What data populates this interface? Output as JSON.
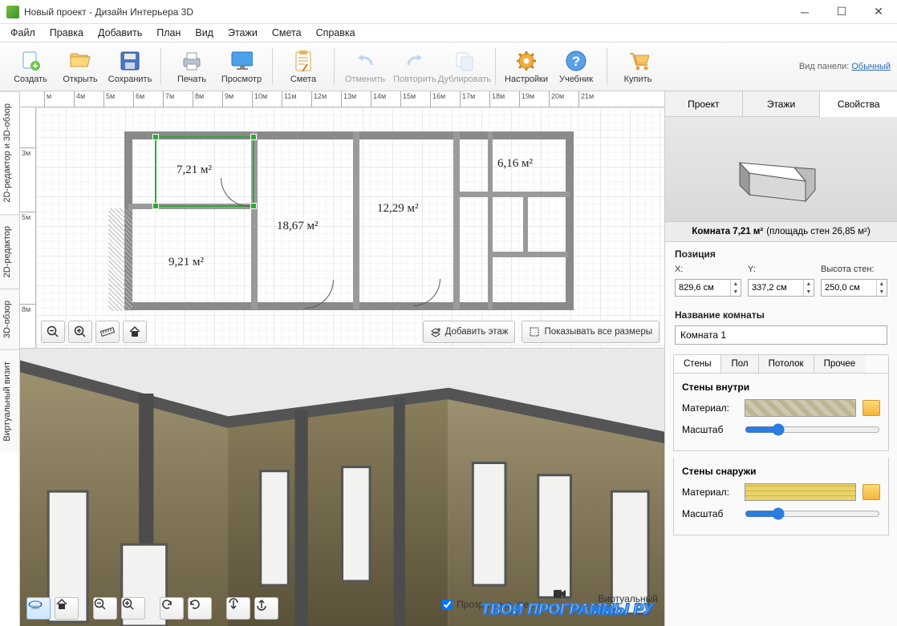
{
  "window": {
    "title": "Новый проект - Дизайн Интерьера 3D"
  },
  "menu": {
    "file": "Файл",
    "edit": "Правка",
    "add": "Добавить",
    "plan": "План",
    "view": "Вид",
    "floors": "Этажи",
    "smeta": "Смета",
    "help": "Справка"
  },
  "toolbar": {
    "create": "Создать",
    "open": "Открыть",
    "save": "Сохранить",
    "print": "Печать",
    "preview": "Просмотр",
    "smeta": "Смета",
    "undo": "Отменить",
    "redo": "Повторить",
    "duplicate": "Дублировать",
    "settings": "Настройки",
    "tutorial": "Учебник",
    "buy": "Купить",
    "panel_label": "Вид панели:",
    "panel_mode": "Обычный"
  },
  "leftTabs": {
    "t1": "2D-редактор и 3D-обзор",
    "t2": "2D-редактор",
    "t3": "3D-обзор",
    "t4": "Виртуальный визит"
  },
  "ruler": {
    "marks": [
      "м",
      "4м",
      "5м",
      "6м",
      "7м",
      "8м",
      "9м",
      "10м",
      "11м",
      "12м",
      "13м",
      "14м",
      "15м",
      "16м",
      "17м",
      "18м",
      "19м",
      "20м",
      "21м"
    ],
    "vmarks": [
      "3м",
      "5м",
      "8м"
    ]
  },
  "rooms": {
    "r1": "7,21 м²",
    "r2": "6,16 м²",
    "r3": "18,67 м²",
    "r4": "12,29 м²",
    "r5": "9,21 м²"
  },
  "planTools": {
    "addFloor": "Добавить этаж",
    "showAll": "Показывать все размеры"
  },
  "bottom": {
    "transparent": "Прозрачные стены",
    "virtual": "Виртуальный визит"
  },
  "right": {
    "tabs": {
      "project": "Проект",
      "floors": "Этажи",
      "props": "Свойства"
    },
    "roomTitle": "Комната 7,21 м²",
    "wallArea": "(площадь стен 26,85 м²)",
    "section_pos": "Позиция",
    "x": "X:",
    "y": "Y:",
    "h": "Высота стен:",
    "xv": "829,6 см",
    "yv": "337,2 см",
    "hv": "250,0 см",
    "section_name": "Название комнаты",
    "name_value": "Комната 1",
    "subtabs": {
      "walls": "Стены",
      "floor": "Пол",
      "ceiling": "Потолок",
      "other": "Прочее"
    },
    "inner": "Стены внутри",
    "outer": "Стены снаружи",
    "material": "Материал:",
    "scale": "Масштаб"
  },
  "watermark": "ТВОИ ПРОГРАММЫ РУ"
}
